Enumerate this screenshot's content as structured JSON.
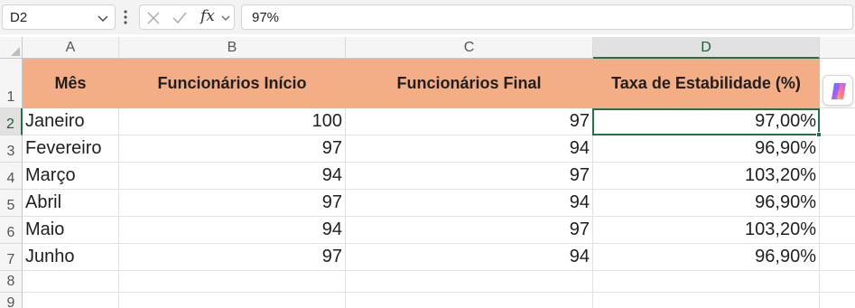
{
  "formula_bar": {
    "name_box": "D2",
    "fx_label": "fx",
    "formula": "97%"
  },
  "columns": [
    "A",
    "B",
    "C",
    "D"
  ],
  "rows": [
    "1",
    "2",
    "3",
    "4",
    "5",
    "6",
    "7",
    "8",
    "9"
  ],
  "selected_cell": "D2",
  "header_fill": "#f4ae86",
  "selection_color": "#217346",
  "table": {
    "headers": [
      "Mês",
      "Funcionários Início",
      "Funcionários Final",
      "Taxa de Estabilidade (%)"
    ],
    "rows": [
      [
        "Janeiro",
        "100",
        "97",
        "97,00%"
      ],
      [
        "Fevereiro",
        "97",
        "94",
        "96,90%"
      ],
      [
        "Março",
        "94",
        "97",
        "103,20%"
      ],
      [
        "Abril",
        "97",
        "94",
        "96,90%"
      ],
      [
        "Maio",
        "94",
        "97",
        "103,20%"
      ],
      [
        "Junho",
        "97",
        "94",
        "96,90%"
      ]
    ]
  },
  "icons": {
    "name_box_dropdown": "chevron-down-icon",
    "more_options": "vertical-dots-icon",
    "cancel": "close-icon",
    "confirm": "check-icon",
    "fx_dropdown": "chevron-down-icon",
    "copilot": "copilot-icon"
  }
}
